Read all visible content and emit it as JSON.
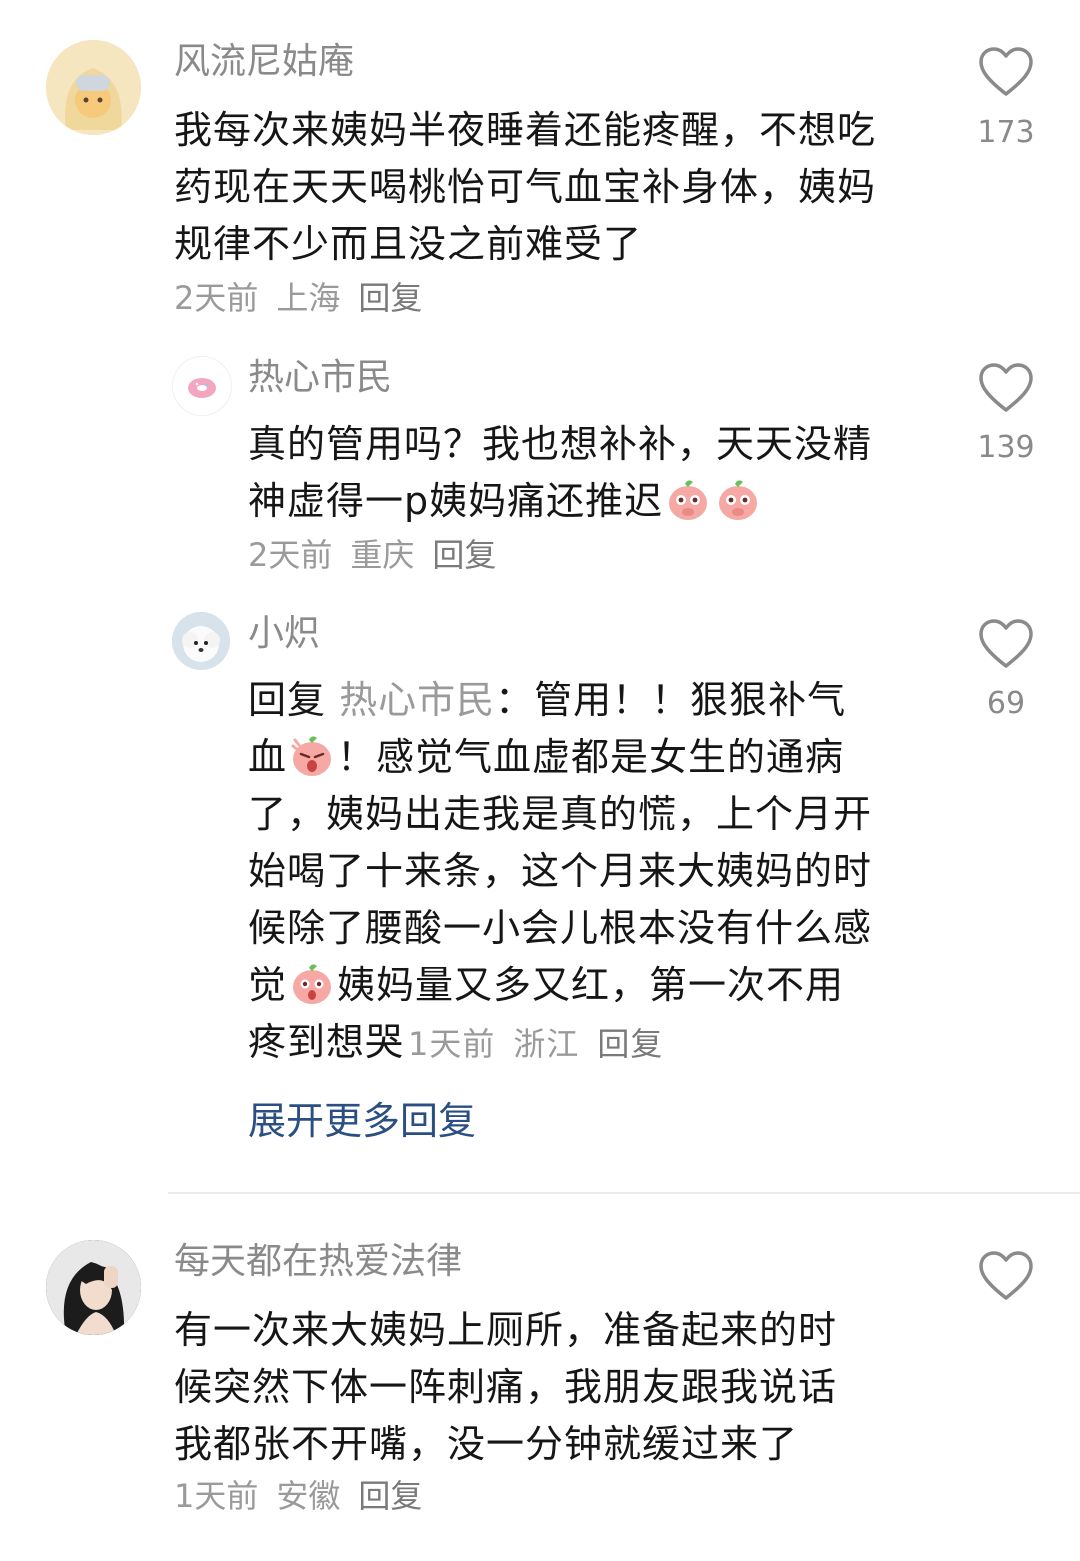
{
  "comments": [
    {
      "username": "风流尼姑庵",
      "lines": [
        "我每次来姨妈半夜睡着还能疼醒，不想吃",
        "药现在天天喝桃怡可气血宝补身体，姨妈",
        "规律不少而且没之前难受了"
      ],
      "time": "2天前",
      "location": "上海",
      "reply_label": "回复",
      "likes": "173"
    },
    {
      "username": "热心市民",
      "lines": [
        "真的管用吗？我也想补补，天天没精",
        "神虚得一p姨妈痛还推迟"
      ],
      "time": "2天前",
      "location": "重庆",
      "reply_label": "回复",
      "likes": "139"
    },
    {
      "username": "小炽",
      "reply_prefix": "回复",
      "mention": "热心市民",
      "line1_rest": "：管用！！狠狠补气",
      "line2_a": "血",
      "line2_b": "！感觉气血虚都是女生的通病",
      "line3": "了，姨妈出走我是真的慌，上个月开",
      "line4": "始喝了十来条，这个月来大姨妈的时",
      "line5": "候除了腰酸一小会儿根本没有什么感",
      "line6_a": "觉",
      "line6_b": "姨妈量又多又红，第一次不用",
      "line7": "疼到想哭",
      "time": "1天前",
      "location": "浙江",
      "reply_label": "回复",
      "likes": "69"
    },
    {
      "username": "每天都在热爱法律",
      "lines": [
        "有一次来大姨妈上厕所，准备起来的时",
        "候突然下体一阵刺痛，我朋友跟我说话",
        "我都张不开嘴，没一分钟就缓过来了"
      ],
      "time": "1天前",
      "location": "安徽",
      "reply_label": "回复"
    }
  ],
  "expand_replies": "展开更多回复",
  "colors": {
    "link": "#2b4f82",
    "text": "#161616",
    "meta": "#9a9a9a"
  }
}
